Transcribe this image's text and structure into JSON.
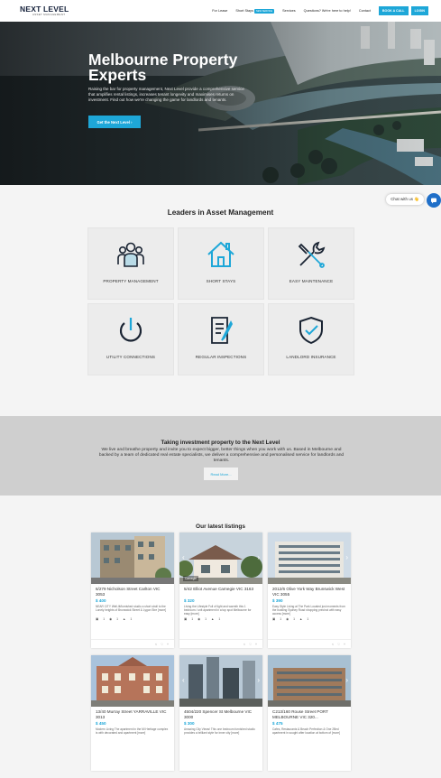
{
  "header": {
    "logo_main": "NEXT LEVEL",
    "logo_sub": "ASSET MANAGEMENT",
    "nav": [
      {
        "label": "For Lease"
      },
      {
        "label": "Short Stays",
        "badge": "NEW SERVICE"
      },
      {
        "label": "Services"
      },
      {
        "label": "Questions? We're here to help!"
      },
      {
        "label": "Contact"
      }
    ],
    "book_call": "BOOK A CALL",
    "login": "LOGIN"
  },
  "hero": {
    "title": "Melbourne Property Experts",
    "text": "Raising the bar for property management, Next Level provide a comprehensive service that amplifies rental listings, increases tenant longevity and maximises returns on investment. Find out how we're changing the game for landlords and tenants.",
    "button": "Get the Next Level  ›"
  },
  "services": {
    "title": "Leaders in Asset Management",
    "items": [
      {
        "label": "PROPERTY MANAGEMENT",
        "icon": "people-icon"
      },
      {
        "label": "SHORT STAYS",
        "icon": "house-icon"
      },
      {
        "label": "EASY MAINTENANCE",
        "icon": "tools-icon"
      },
      {
        "label": "UTILITY CONNECTIONS",
        "icon": "power-icon"
      },
      {
        "label": "REGULAR INSPECTIONS",
        "icon": "document-icon"
      },
      {
        "label": "LANDLORD INSURANCE",
        "icon": "shield-icon"
      }
    ]
  },
  "band": {
    "title": "Taking investment property to the Next Level",
    "text": "We live and breathe property and invite you to expect bigger, better things when you work with us. Based in Melbourne and backed by a team of dedicated real estate specialists, we deliver a comprehensive and personalised service for landlords and tenants.",
    "button": "Read More..."
  },
  "listings": {
    "title": "Our latest listings",
    "items": [
      {
        "address": "6/279 Nicholson Street Carlton VIC 3053",
        "price": "$ 400",
        "desc": "NEAR CITY Well-lit/furnished studio a short stroll to the Lonely heights of Brunswick Street & Lygon Stre [more]",
        "beds": "1",
        "baths": "1",
        "cars": "1",
        "tag": ""
      },
      {
        "address": "5/42 Elliot Avenue Carnegie VIC 3163",
        "price": "$ 320",
        "desc": "Living the Lifestyle Full of light and warmth this 1 bedroom / unit apartment in a top spot Melbourne for easy [more]",
        "beds": "1",
        "baths": "1",
        "cars": "1",
        "tag": "Carnegie"
      },
      {
        "address": "2012/6 Olive York Way Brunswick West VIC 3055",
        "price": "$ 390",
        "desc": "Easy Style Living at The Park Located just moments from the bustling Sydney Road shopping precinct with easy access [more]",
        "beds": "1",
        "baths": "1",
        "cars": "1",
        "tag": ""
      },
      {
        "address": "13/40 Murray Street YARRAVILLE VIC 3013",
        "price": "$ 450",
        "desc": "Modern Living The apartment in the Mi Heritage complex is with decorated and apartment [more]",
        "beds": "",
        "baths": "",
        "cars": "",
        "tag": ""
      },
      {
        "address": "4504/220 Spencer St Melbourne VIC 3000",
        "price": "$ 300",
        "desc": "Amazing City Views! This one bedroom furnished studio provides a brilliant style for inner city [more]",
        "beds": "",
        "baths": "",
        "cars": "",
        "tag": ""
      },
      {
        "address": "C213/160 Rouse Street PORT MELBOURNE VIC 320...",
        "price": "$ 475",
        "desc": "Cafes, Restaurants & Beach Perfection & One 2Bed apartment in sought after location at bottom of [more]",
        "beds": "",
        "baths": "",
        "cars": "",
        "tag": ""
      }
    ]
  },
  "chat": {
    "label": "Chat with us 👋"
  },
  "colors": {
    "accent": "#1ea7d8",
    "navy": "#15213b",
    "band": "#cfcfcf"
  }
}
